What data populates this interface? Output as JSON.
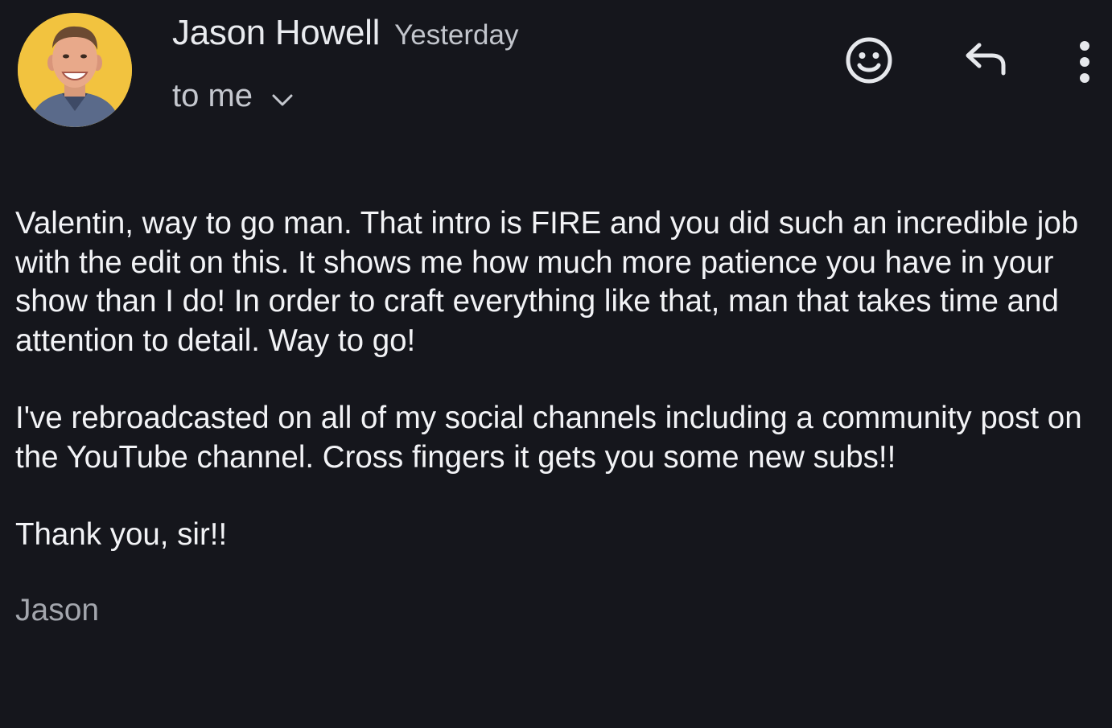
{
  "message": {
    "sender": {
      "name": "Jason Howell",
      "time": "Yesterday",
      "avatar_icon": "sender-avatar",
      "avatar_bg": "#f2c33f"
    },
    "recipient": {
      "label": "to me",
      "expand_icon": "chevron-down-icon"
    },
    "actions": [
      {
        "name": "add-reaction",
        "icon": "emoji-icon"
      },
      {
        "name": "reply",
        "icon": "reply-icon"
      },
      {
        "name": "more-options",
        "icon": "more-vert-icon"
      }
    ],
    "paragraphs": [
      "Valentin, way to go man. That intro is FIRE and you did such an incredible job with the edit on this. It shows me how much more patience you have in your show than I do! In order to craft everything like that, man that takes time and attention to detail. Way to go!",
      "I've rebroadcasted on all of my social channels including a community post on the YouTube channel. Cross fingers it gets you some new subs!!",
      "Thank you, sir!!"
    ],
    "signature": "Jason"
  },
  "colors": {
    "background": "#15161c",
    "text": "#f2f3f6",
    "muted": "#a3a6ad",
    "icon": "#e6e8ec"
  }
}
